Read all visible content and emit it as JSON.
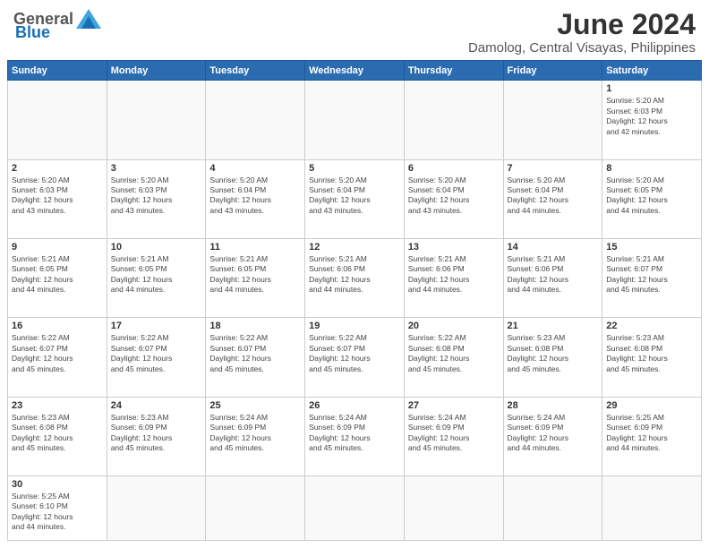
{
  "header": {
    "logo": {
      "general": "General",
      "blue": "Blue"
    },
    "title": "June 2024",
    "subtitle": "Damolog, Central Visayas, Philippines"
  },
  "calendar": {
    "days": [
      "Sunday",
      "Monday",
      "Tuesday",
      "Wednesday",
      "Thursday",
      "Friday",
      "Saturday"
    ],
    "weeks": [
      [
        {
          "day": "",
          "info": "",
          "empty": true
        },
        {
          "day": "",
          "info": "",
          "empty": true
        },
        {
          "day": "",
          "info": "",
          "empty": true
        },
        {
          "day": "",
          "info": "",
          "empty": true
        },
        {
          "day": "",
          "info": "",
          "empty": true
        },
        {
          "day": "",
          "info": "",
          "empty": true
        },
        {
          "day": "1",
          "info": "Sunrise: 5:20 AM\nSunset: 6:03 PM\nDaylight: 12 hours\nand 42 minutes."
        }
      ],
      [
        {
          "day": "2",
          "info": "Sunrise: 5:20 AM\nSunset: 6:03 PM\nDaylight: 12 hours\nand 43 minutes."
        },
        {
          "day": "3",
          "info": "Sunrise: 5:20 AM\nSunset: 6:03 PM\nDaylight: 12 hours\nand 43 minutes."
        },
        {
          "day": "4",
          "info": "Sunrise: 5:20 AM\nSunset: 6:04 PM\nDaylight: 12 hours\nand 43 minutes."
        },
        {
          "day": "5",
          "info": "Sunrise: 5:20 AM\nSunset: 6:04 PM\nDaylight: 12 hours\nand 43 minutes."
        },
        {
          "day": "6",
          "info": "Sunrise: 5:20 AM\nSunset: 6:04 PM\nDaylight: 12 hours\nand 43 minutes."
        },
        {
          "day": "7",
          "info": "Sunrise: 5:20 AM\nSunset: 6:04 PM\nDaylight: 12 hours\nand 44 minutes."
        },
        {
          "day": "8",
          "info": "Sunrise: 5:20 AM\nSunset: 6:05 PM\nDaylight: 12 hours\nand 44 minutes."
        }
      ],
      [
        {
          "day": "9",
          "info": "Sunrise: 5:21 AM\nSunset: 6:05 PM\nDaylight: 12 hours\nand 44 minutes."
        },
        {
          "day": "10",
          "info": "Sunrise: 5:21 AM\nSunset: 6:05 PM\nDaylight: 12 hours\nand 44 minutes."
        },
        {
          "day": "11",
          "info": "Sunrise: 5:21 AM\nSunset: 6:05 PM\nDaylight: 12 hours\nand 44 minutes."
        },
        {
          "day": "12",
          "info": "Sunrise: 5:21 AM\nSunset: 6:06 PM\nDaylight: 12 hours\nand 44 minutes."
        },
        {
          "day": "13",
          "info": "Sunrise: 5:21 AM\nSunset: 6:06 PM\nDaylight: 12 hours\nand 44 minutes."
        },
        {
          "day": "14",
          "info": "Sunrise: 5:21 AM\nSunset: 6:06 PM\nDaylight: 12 hours\nand 44 minutes."
        },
        {
          "day": "15",
          "info": "Sunrise: 5:21 AM\nSunset: 6:07 PM\nDaylight: 12 hours\nand 45 minutes."
        }
      ],
      [
        {
          "day": "16",
          "info": "Sunrise: 5:22 AM\nSunset: 6:07 PM\nDaylight: 12 hours\nand 45 minutes."
        },
        {
          "day": "17",
          "info": "Sunrise: 5:22 AM\nSunset: 6:07 PM\nDaylight: 12 hours\nand 45 minutes."
        },
        {
          "day": "18",
          "info": "Sunrise: 5:22 AM\nSunset: 6:07 PM\nDaylight: 12 hours\nand 45 minutes."
        },
        {
          "day": "19",
          "info": "Sunrise: 5:22 AM\nSunset: 6:07 PM\nDaylight: 12 hours\nand 45 minutes."
        },
        {
          "day": "20",
          "info": "Sunrise: 5:22 AM\nSunset: 6:08 PM\nDaylight: 12 hours\nand 45 minutes."
        },
        {
          "day": "21",
          "info": "Sunrise: 5:23 AM\nSunset: 6:08 PM\nDaylight: 12 hours\nand 45 minutes."
        },
        {
          "day": "22",
          "info": "Sunrise: 5:23 AM\nSunset: 6:08 PM\nDaylight: 12 hours\nand 45 minutes."
        }
      ],
      [
        {
          "day": "23",
          "info": "Sunrise: 5:23 AM\nSunset: 6:08 PM\nDaylight: 12 hours\nand 45 minutes."
        },
        {
          "day": "24",
          "info": "Sunrise: 5:23 AM\nSunset: 6:09 PM\nDaylight: 12 hours\nand 45 minutes."
        },
        {
          "day": "25",
          "info": "Sunrise: 5:24 AM\nSunset: 6:09 PM\nDaylight: 12 hours\nand 45 minutes."
        },
        {
          "day": "26",
          "info": "Sunrise: 5:24 AM\nSunset: 6:09 PM\nDaylight: 12 hours\nand 45 minutes."
        },
        {
          "day": "27",
          "info": "Sunrise: 5:24 AM\nSunset: 6:09 PM\nDaylight: 12 hours\nand 45 minutes."
        },
        {
          "day": "28",
          "info": "Sunrise: 5:24 AM\nSunset: 6:09 PM\nDaylight: 12 hours\nand 44 minutes."
        },
        {
          "day": "29",
          "info": "Sunrise: 5:25 AM\nSunset: 6:09 PM\nDaylight: 12 hours\nand 44 minutes."
        }
      ],
      [
        {
          "day": "30",
          "info": "Sunrise: 5:25 AM\nSunset: 6:10 PM\nDaylight: 12 hours\nand 44 minutes."
        },
        {
          "day": "",
          "info": "",
          "empty": true
        },
        {
          "day": "",
          "info": "",
          "empty": true
        },
        {
          "day": "",
          "info": "",
          "empty": true
        },
        {
          "day": "",
          "info": "",
          "empty": true
        },
        {
          "day": "",
          "info": "",
          "empty": true
        },
        {
          "day": "",
          "info": "",
          "empty": true
        }
      ]
    ]
  }
}
